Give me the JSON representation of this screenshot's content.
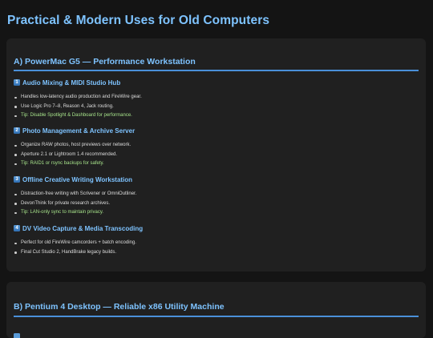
{
  "page": {
    "title": "Practical & Modern Uses for Old Computers"
  },
  "cards": [
    {
      "title": "A) PowerMac G5 — Performance Workstation",
      "sections": [
        {
          "number": "1",
          "icon": "keycap-1-icon",
          "title": "Audio Mixing & MIDI Studio Hub",
          "items": [
            "Handles low-latency audio production and FireWire gear.",
            "Use Logic Pro 7–8, Reason 4, Jack routing."
          ],
          "tip": "Tip: Disable Spotlight & Dashboard for performance."
        },
        {
          "number": "2",
          "icon": "keycap-2-icon",
          "title": "Photo Management & Archive Server",
          "items": [
            "Organize RAW photos, host previews over network.",
            "Aperture 2.1 or Lightroom 1.4 recommended."
          ],
          "tip": "Tip: RAID1 or rsync backups for safety."
        },
        {
          "number": "3",
          "icon": "keycap-3-icon",
          "title": "Offline Creative Writing Workstation",
          "items": [
            "Distraction-free writing with Scrivener or OmniOutliner.",
            "DevonThink for private research archives."
          ],
          "tip": "Tip: LAN-only sync to maintain privacy."
        },
        {
          "number": "4",
          "icon": "keycap-4-icon",
          "title": "DV Video Capture & Media Transcoding",
          "items": [
            "Perfect for old FireWire camcorders + batch encoding.",
            "Final Cut Studio 2, HandBrake legacy builds."
          ],
          "tip": ""
        }
      ]
    },
    {
      "title": "B) Pentium 4 Desktop — Reliable x86 Utility Machine"
    }
  ],
  "colors": {
    "background": "#141414",
    "card": "#202020",
    "accent": "#7ec3ff",
    "divider": "#4a90d9",
    "tip": "#a6e28a"
  }
}
